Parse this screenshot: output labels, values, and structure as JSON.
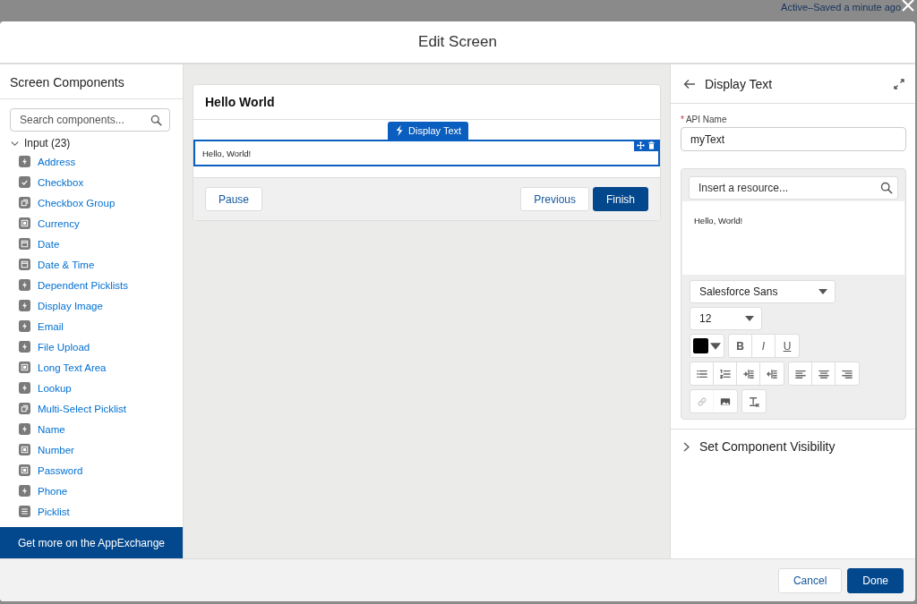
{
  "status_text": "Active–Saved a minute ago",
  "modal": {
    "title": "Edit Screen"
  },
  "components_panel": {
    "title": "Screen Components",
    "search": {
      "placeholder": "Search components..."
    },
    "group": {
      "label": "Input (23)",
      "expanded": true,
      "items": [
        {
          "label": "Address",
          "kind": "bolt"
        },
        {
          "label": "Checkbox",
          "kind": "check"
        },
        {
          "label": "Checkbox Group",
          "kind": "group"
        },
        {
          "label": "Currency",
          "kind": "box"
        },
        {
          "label": "Date",
          "kind": "calendar"
        },
        {
          "label": "Date & Time",
          "kind": "calendar"
        },
        {
          "label": "Dependent Picklists",
          "kind": "bolt"
        },
        {
          "label": "Display Image",
          "kind": "bolt"
        },
        {
          "label": "Email",
          "kind": "bolt"
        },
        {
          "label": "File Upload",
          "kind": "bolt"
        },
        {
          "label": "Long Text Area",
          "kind": "box"
        },
        {
          "label": "Lookup",
          "kind": "bolt"
        },
        {
          "label": "Multi-Select Picklist",
          "kind": "group"
        },
        {
          "label": "Name",
          "kind": "bolt"
        },
        {
          "label": "Number",
          "kind": "box"
        },
        {
          "label": "Password",
          "kind": "box"
        },
        {
          "label": "Phone",
          "kind": "bolt"
        },
        {
          "label": "Picklist",
          "kind": "list"
        }
      ]
    },
    "appexchange": "Get more on the AppExchange"
  },
  "canvas": {
    "screen_title": "Hello World",
    "tag": "Display Text",
    "text": "Hello, World!",
    "buttons": [
      {
        "label": "Pause",
        "primary": false
      },
      {
        "label": "Previous",
        "primary": false
      },
      {
        "label": "Finish",
        "primary": true
      }
    ]
  },
  "properties": {
    "title": "Display Text",
    "required_marker": "*",
    "api_label": "API Name",
    "api_value": "myText",
    "resource": {
      "placeholder": "Insert a resource..."
    },
    "body": "Hello, World!",
    "font": "Salesforce Sans",
    "size": "12",
    "toolbar": [
      [
        {
          "kind": "color"
        }
      ],
      [
        {
          "kind": "bold",
          "label": "B"
        },
        {
          "kind": "italic",
          "label": "I"
        },
        {
          "kind": "underline",
          "label": "U"
        }
      ],
      [
        {
          "kind": "bullets"
        },
        {
          "kind": "numbers"
        },
        {
          "kind": "outdent"
        },
        {
          "kind": "indent"
        }
      ],
      [
        {
          "kind": "align-left"
        },
        {
          "kind": "align-center"
        },
        {
          "kind": "align-right"
        }
      ],
      [
        {
          "kind": "link",
          "disabled": true
        },
        {
          "kind": "image",
          "disabled": false
        }
      ],
      [
        {
          "kind": "clear",
          "disabled": false
        }
      ]
    ],
    "visibility": {
      "label": "Set Component Visibility",
      "expanded": false
    }
  },
  "footer": {
    "buttons": [
      {
        "label": "Cancel",
        "primary": false
      },
      {
        "label": "Done",
        "primary": true
      }
    ]
  }
}
